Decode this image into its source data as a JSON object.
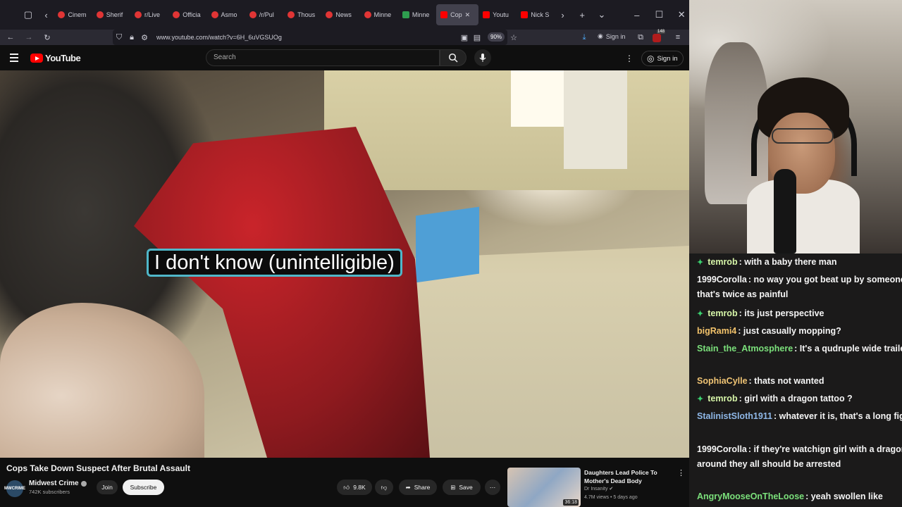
{
  "browser": {
    "tabs": [
      {
        "label": "Cinem",
        "favicon": "red-circle"
      },
      {
        "label": "Sherif",
        "favicon": "red-circle"
      },
      {
        "label": "r/Live",
        "favicon": "red-circle"
      },
      {
        "label": "Officia",
        "favicon": "red-circle"
      },
      {
        "label": "Asmo",
        "favicon": "red-circle"
      },
      {
        "label": "/r/Pul",
        "favicon": "red-circle"
      },
      {
        "label": "Thous",
        "favicon": "red-circle"
      },
      {
        "label": "News",
        "favicon": "red-circle"
      },
      {
        "label": "Minne",
        "favicon": "red-circle"
      },
      {
        "label": "Minne",
        "favicon": "green-square"
      },
      {
        "label": "Cop",
        "favicon": "red-square",
        "active": true
      },
      {
        "label": "Youtu",
        "favicon": "red-square"
      },
      {
        "label": "Nick S",
        "favicon": "red-square"
      }
    ],
    "url": "www.youtube.com/watch?v=6H_6uVGSUOg",
    "zoom": "90%",
    "signin_label": "Sign in",
    "downloads_badge": "148"
  },
  "youtube": {
    "logo_text": "YouTube",
    "search_placeholder": "Search",
    "signin_label": "Sign in",
    "caption": "I don't know (unintelligible)",
    "video_title": "Cops Take Down Suspect After Brutal Assault",
    "channel": {
      "name": "Midwest Crime",
      "subs": "742K subscribers",
      "avatar_text": "MWCRIME"
    },
    "join_label": "Join",
    "subscribe_label": "Subscribe",
    "likes": "9.8K",
    "share_label": "Share",
    "save_label": "Save",
    "recommendation": {
      "title": "Daughters Lead Police To Mother's Dead Body",
      "channel": "Dr Insanity",
      "meta": "4.7M views • 5 days ago",
      "duration": "36:18"
    }
  },
  "chat": {
    "accent_green": "#3bd16f",
    "messages": [
      {
        "user": "temrob",
        "color": "#d6f5a8",
        "badge": true,
        "text": ": with a baby there man"
      },
      {
        "user": "1999Corolla",
        "color": "#f5f5f5",
        "badge": false,
        "text": ": no way you got beat up by someone named mervel.. that's twice as painful"
      },
      {
        "user": "temrob",
        "color": "#d6f5a8",
        "badge": true,
        "text": ": its just perspective"
      },
      {
        "user": "bigRami4",
        "color": "#f3c36b",
        "badge": false,
        "text": ": just casually mopping?"
      },
      {
        "user": "Stain_the_Atmosphere",
        "color": "#7be07b",
        "badge": false,
        "text": ": It's a qudruple wide trailer"
      },
      {
        "user": "SophiaCylle",
        "color": "#f0c474",
        "badge": false,
        "text": ": thats not wanted"
      },
      {
        "user": "temrob",
        "color": "#d6f5a8",
        "badge": true,
        "text": ": girl with a dragon tattoo ?"
      },
      {
        "user": "StalinistSloth1911",
        "color": "#8fb8e8",
        "badge": false,
        "text": ": whatever it is, that's a long fight scene no?"
      },
      {
        "user": "1999Corolla",
        "color": "#f5f5f5",
        "badge": false,
        "text": ": if they're watchign girl with a dragon tattoo with a kid around they all should be arrested"
      },
      {
        "user": "AngryMooseOnTheLoose",
        "color": "#7be07b",
        "badge": false,
        "text": ": yeah swollen like"
      }
    ]
  }
}
